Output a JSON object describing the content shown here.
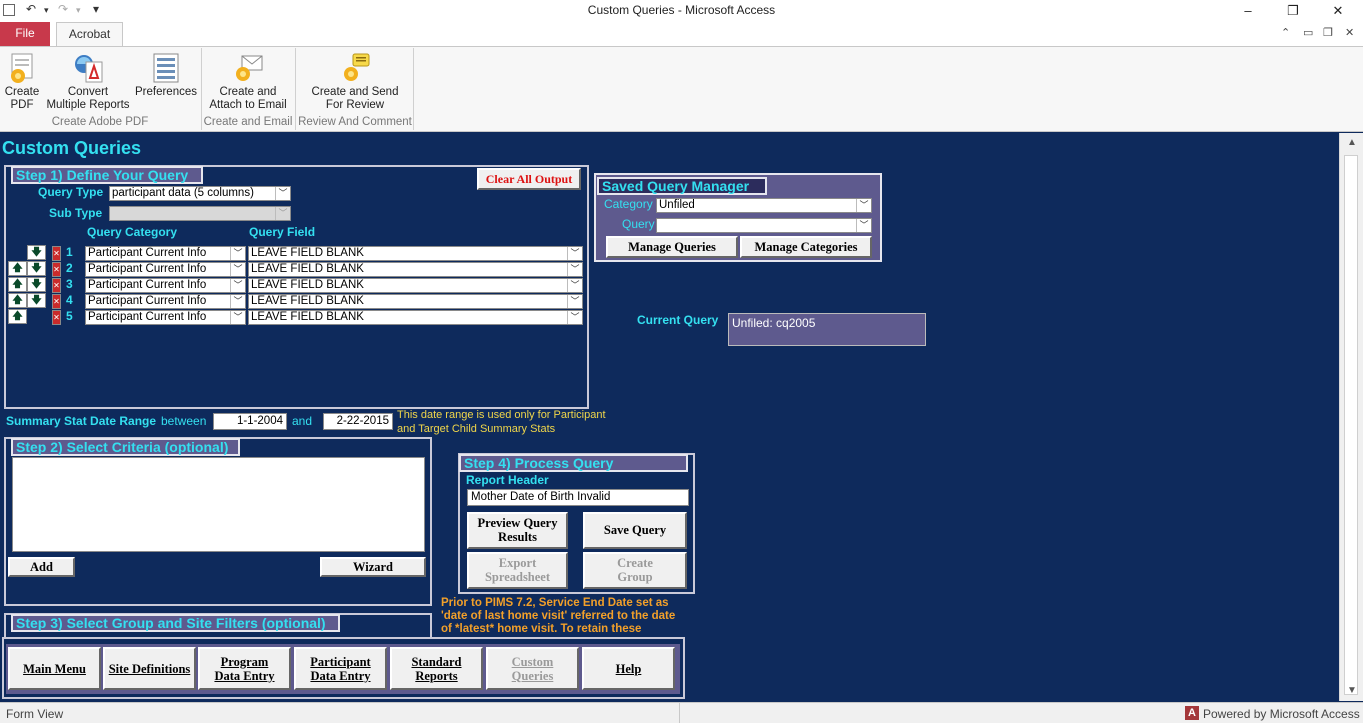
{
  "window": {
    "title": "Custom Queries  -  Microsoft Access",
    "controls": {
      "minimize": "–",
      "restore": "❐",
      "close": "✕"
    },
    "qat": {
      "undo": "↶",
      "redo": "↷",
      "customize": "▾"
    }
  },
  "ribbon": {
    "tabs": {
      "file": "File",
      "acrobat": "Acrobat"
    },
    "groups": [
      {
        "label": "Create Adobe PDF",
        "buttons": [
          {
            "label1": "Create",
            "label2": "PDF"
          },
          {
            "label1": "Convert",
            "label2": "Multiple Reports"
          },
          {
            "label1": "Preferences",
            "label2": ""
          }
        ]
      },
      {
        "label": "Create and Email",
        "buttons": [
          {
            "label1": "Create and",
            "label2": "Attach to Email"
          }
        ]
      },
      {
        "label": "Review And Comment",
        "buttons": [
          {
            "label1": "Create and Send",
            "label2": "For Review"
          }
        ]
      }
    ]
  },
  "form": {
    "heading": "Custom Queries",
    "step1": {
      "title": "Step 1) Define Your Query",
      "clear_label": "Clear All Output",
      "query_type_label": "Query Type",
      "query_type_value": "participant data (5 columns)",
      "sub_type_label": "Sub Type",
      "sub_type_value": "",
      "category_header": "Query Category",
      "field_header": "Query Field",
      "rows": [
        {
          "num": "1",
          "category": "Participant Current Info",
          "field": "LEAVE FIELD BLANK"
        },
        {
          "num": "2",
          "category": "Participant Current Info",
          "field": "LEAVE FIELD BLANK"
        },
        {
          "num": "3",
          "category": "Participant Current Info",
          "field": "LEAVE FIELD BLANK"
        },
        {
          "num": "4",
          "category": "Participant Current Info",
          "field": "LEAVE FIELD BLANK"
        },
        {
          "num": "5",
          "category": "Participant Current Info",
          "field": "LEAVE FIELD BLANK"
        }
      ]
    },
    "summary": {
      "label": "Summary Stat Date Range",
      "between": "between",
      "start": "1-1-2004",
      "and": "and",
      "end": "2-22-2015",
      "note1": "This date range is used only for Participant",
      "note2": "and Target Child Summary Stats"
    },
    "step2": {
      "title": "Step 2) Select Criteria (optional)",
      "add_label": "Add",
      "wizard_label": "Wizard"
    },
    "step3": {
      "title": "Step 3) Select Group and Site Filters (optional)"
    },
    "saved": {
      "title": "Saved Query Manager",
      "category_label": "Category",
      "category_value": "Unfiled",
      "query_label": "Query",
      "query_value": "",
      "manage_queries": "Manage Queries",
      "manage_categories": "Manage Categories"
    },
    "current": {
      "label": "Current Query",
      "value": "Unfiled: cq2005"
    },
    "step4": {
      "title": "Step 4) Process Query",
      "report_header_label": "Report Header",
      "report_header_value": "Mother Date of Birth Invalid",
      "preview1": "Preview Query",
      "preview2": "Results",
      "save": "Save Query",
      "export1": "Export",
      "export2": "Spreadsheet",
      "group1": "Create",
      "group2": "Group"
    },
    "notice": {
      "line1": "Prior to PIMS 7.2, Service End Date set as",
      "line2": "'date of last home visit' referred to the date",
      "line3": "of *latest* home visit. To retain these"
    },
    "nav": [
      {
        "l1": "Main Menu",
        "l2": ""
      },
      {
        "l1": "Site Definitions",
        "l2": ""
      },
      {
        "l1": "Program",
        "l2": "Data Entry"
      },
      {
        "l1": "Participant",
        "l2": "Data Entry"
      },
      {
        "l1": "Standard",
        "l2": "Reports"
      },
      {
        "l1": "Custom",
        "l2": "Queries"
      },
      {
        "l1": "Help",
        "l2": ""
      }
    ]
  },
  "status": {
    "left": "Form View",
    "right": "Powered by Microsoft Access",
    "badge": "A"
  }
}
